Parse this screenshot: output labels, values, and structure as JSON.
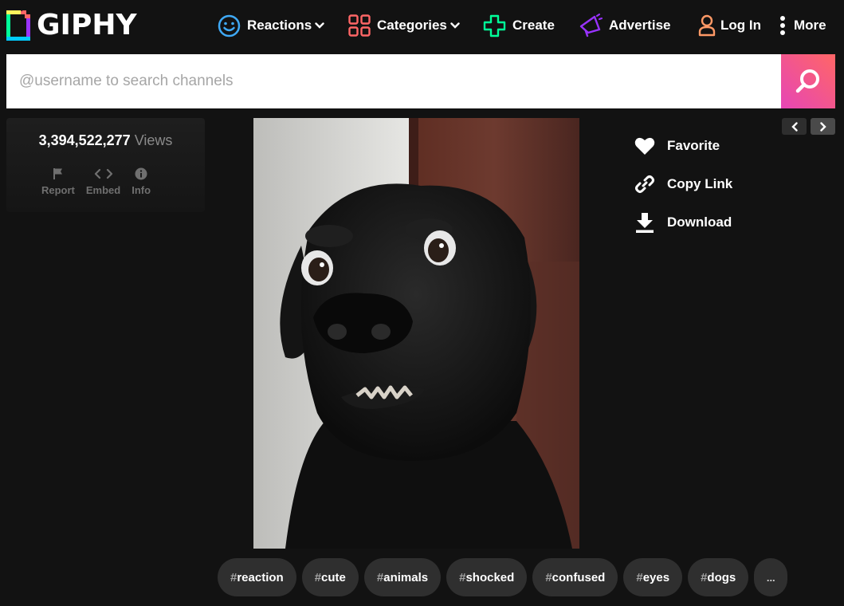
{
  "header": {
    "logo_text": "GIPHY",
    "nav": [
      {
        "label": "Reactions",
        "icon": "smiley-icon",
        "color": "#3fa9f5"
      },
      {
        "label": "Categories",
        "icon": "grid-icon",
        "color": "#ff6666"
      },
      {
        "label": "Create",
        "icon": "plus-icon",
        "color": "#00ff99"
      },
      {
        "label": "Advertise",
        "icon": "megaphone-icon",
        "color": "#9933ff"
      },
      {
        "label": "Log In",
        "icon": "user-icon",
        "color": "#ff9966"
      },
      {
        "label": "More",
        "icon": "kebab-icon",
        "color": "#ffffff"
      }
    ]
  },
  "search": {
    "placeholder": "@username to search channels",
    "button_color": "#e646b6"
  },
  "stats": {
    "views_count": "3,394,522,277",
    "views_label": "Views",
    "actions": [
      {
        "label": "Report",
        "icon": "flag-icon"
      },
      {
        "label": "Embed",
        "icon": "code-icon"
      },
      {
        "label": "Info",
        "icon": "info-icon"
      }
    ]
  },
  "gif": {
    "subject": "black-dog-gif"
  },
  "actions": [
    {
      "label": "Favorite",
      "icon": "heart-icon"
    },
    {
      "label": "Copy Link",
      "icon": "link-icon"
    },
    {
      "label": "Download",
      "icon": "download-icon"
    }
  ],
  "tags": [
    {
      "hash": "#",
      "label": "reaction"
    },
    {
      "hash": "#",
      "label": "cute"
    },
    {
      "hash": "#",
      "label": "animals"
    },
    {
      "hash": "#",
      "label": "shocked"
    },
    {
      "hash": "#",
      "label": "confused"
    },
    {
      "hash": "#",
      "label": "eyes"
    },
    {
      "hash": "#",
      "label": "dogs"
    }
  ],
  "tags_more_label": "..."
}
